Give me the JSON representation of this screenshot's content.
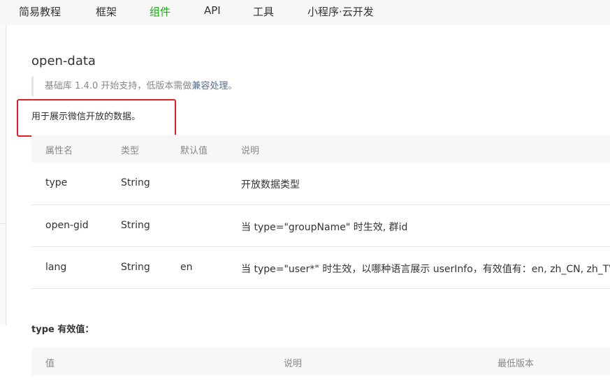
{
  "nav": {
    "items": [
      {
        "label": "简易教程",
        "active": false
      },
      {
        "label": "框架",
        "active": false
      },
      {
        "label": "组件",
        "active": true
      },
      {
        "label": "API",
        "active": false
      },
      {
        "label": "工具",
        "active": false
      },
      {
        "label": "小程序·云开发",
        "active": false
      }
    ],
    "active_color": "#1aad19"
  },
  "page": {
    "title": "open-data",
    "note_prefix": "基础库 1.4.0 开始支持，低版本需做",
    "note_link": "兼容处理",
    "note_suffix": "。",
    "description": "用于展示微信开放的数据。",
    "highlight_color": "#e02020"
  },
  "attr_table": {
    "headers": [
      "属性名",
      "类型",
      "默认值",
      "说明"
    ],
    "rows": [
      {
        "name": "type",
        "type": "String",
        "default": "",
        "desc": "开放数据类型"
      },
      {
        "name": "open-gid",
        "type": "String",
        "default": "",
        "desc": "当 type=\"groupName\" 时生效, 群id"
      },
      {
        "name": "lang",
        "type": "String",
        "default": "en",
        "desc": "当 type=\"user*\" 时生效，以哪种语言展示 userInfo，有效值有：en, zh_CN, zh_TW"
      }
    ]
  },
  "type_section": {
    "label": "type 有效值：",
    "headers": [
      "值",
      "说明",
      "最低版本"
    ]
  }
}
